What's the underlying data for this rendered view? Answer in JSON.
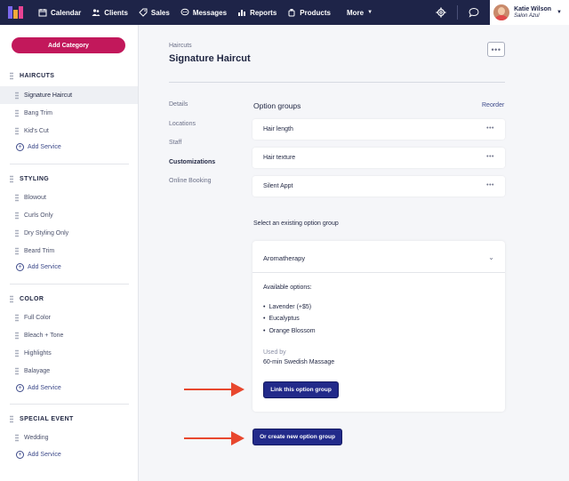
{
  "colors": {
    "nav_bg": "#1e2448",
    "accent_magenta": "#c2185b",
    "primary_button": "#222a8a",
    "annotation_arrow": "#e8472e"
  },
  "topnav": {
    "items": [
      {
        "label": "Calendar",
        "icon": "calendar-icon"
      },
      {
        "label": "Clients",
        "icon": "clients-icon"
      },
      {
        "label": "Sales",
        "icon": "tag-icon"
      },
      {
        "label": "Messages",
        "icon": "messages-icon"
      },
      {
        "label": "Reports",
        "icon": "reports-icon"
      },
      {
        "label": "Products",
        "icon": "products-icon"
      }
    ],
    "more_label": "More",
    "user": {
      "name": "Katie Wilson",
      "salon": "Salon Azul"
    }
  },
  "sidebar": {
    "add_category_label": "Add Category",
    "add_service_label": "Add Service",
    "sections": [
      {
        "title": "HAIRCUTS",
        "items": [
          "Signature Haircut",
          "Bang Trim",
          "Kid's Cut"
        ]
      },
      {
        "title": "STYLING",
        "items": [
          "Blowout",
          "Curls Only",
          "Dry Styling Only",
          "Beard Trim"
        ]
      },
      {
        "title": "COLOR",
        "items": [
          "Full Color",
          "Bleach + Tone",
          "Highlights",
          "Balayage"
        ]
      },
      {
        "title": "SPECIAL EVENT",
        "items": [
          "Wedding"
        ]
      }
    ],
    "active_item": "Signature Haircut"
  },
  "main": {
    "breadcrumb": "Haircuts",
    "title": "Signature Haircut",
    "subnav": [
      "Details",
      "Locations",
      "Staff",
      "Customizations",
      "Online Booking"
    ],
    "active_subnav": "Customizations",
    "option_groups_title": "Option groups",
    "reorder_label": "Reorder",
    "option_groups": [
      "Hair length",
      "Hair texture",
      "Silent Appt"
    ],
    "select_existing_label": "Select an existing option group",
    "selected_group": "Aromatherapy",
    "available_options_label": "Available options:",
    "available_options": [
      "Lavender (+$5)",
      "Eucalyptus",
      "Orange Blossom"
    ],
    "used_by_label": "Used by",
    "used_by_value": "60-min Swedish Massage",
    "link_button_label": "Link this option group",
    "create_button_label": "Or create new option group"
  }
}
